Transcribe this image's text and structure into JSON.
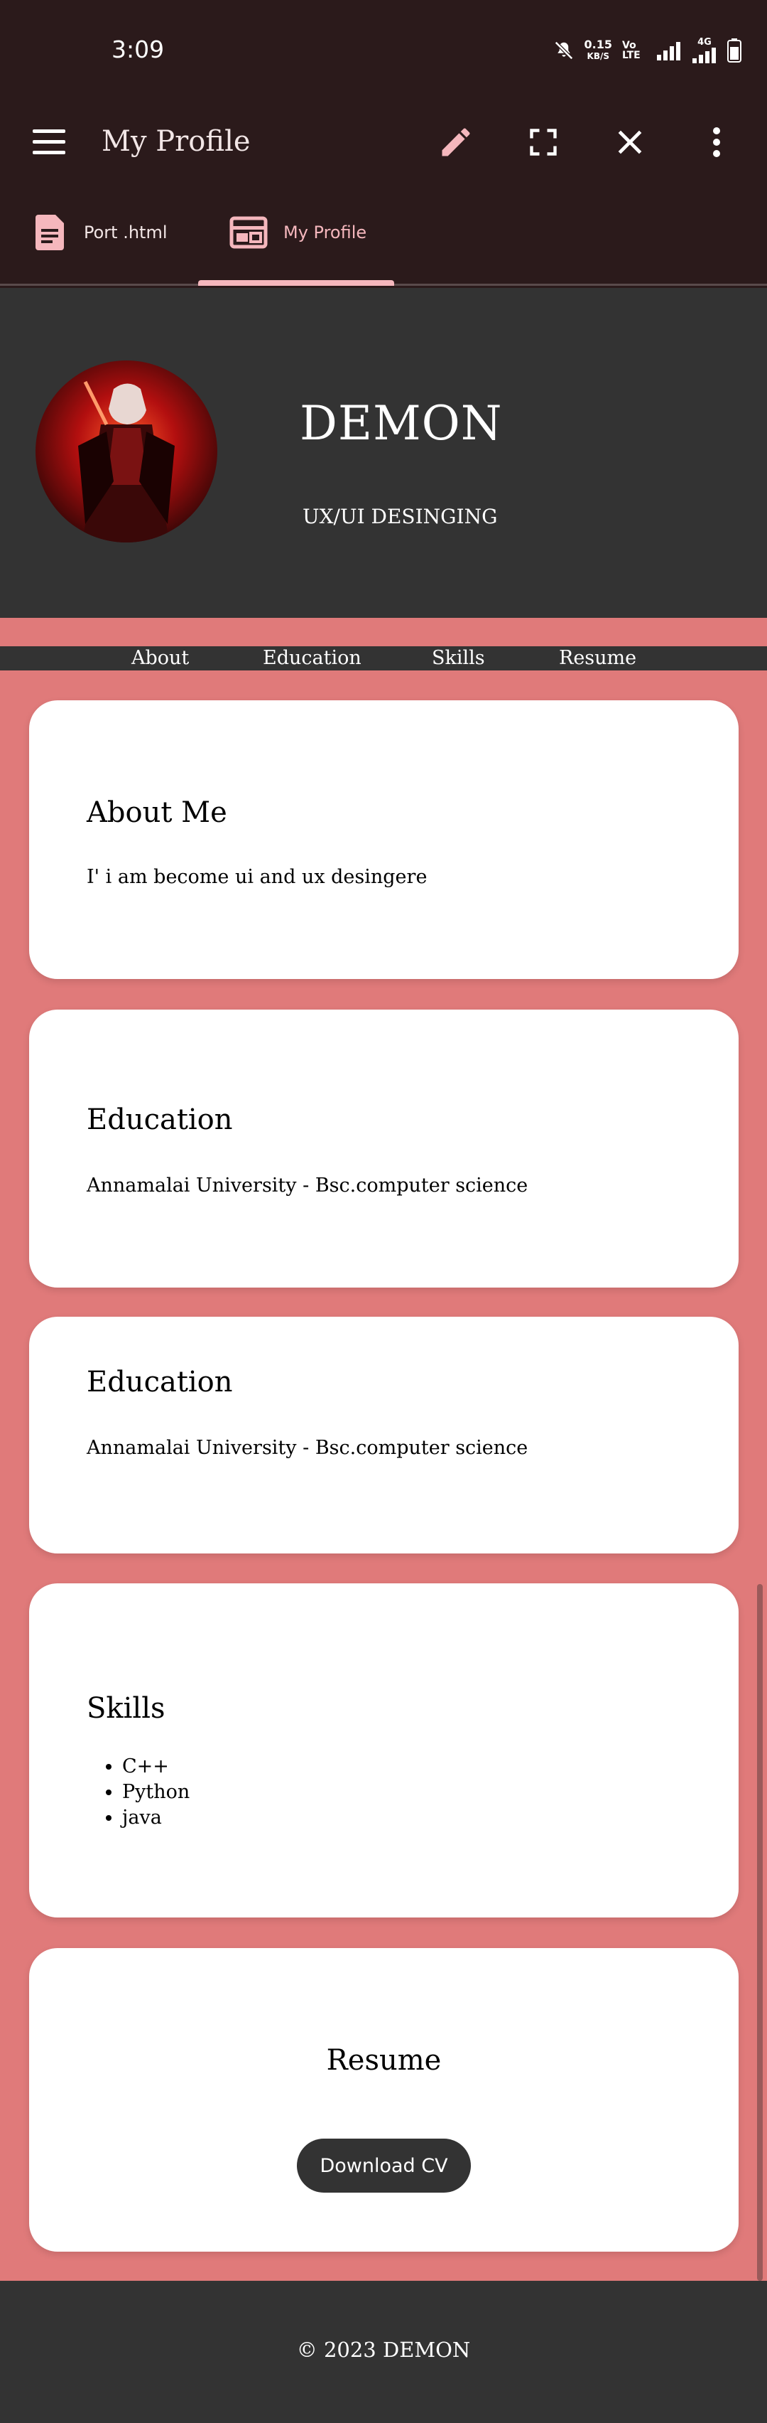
{
  "status": {
    "time": "3:09",
    "speed_value": "0.15",
    "speed_unit": "KB/S",
    "volte": "Vo LTE",
    "network": "4G"
  },
  "app_bar": {
    "title": "My Profile"
  },
  "tabs": [
    {
      "label": "Port .html",
      "active": false
    },
    {
      "label": "My Profile",
      "active": true
    }
  ],
  "profile": {
    "name": "DEMON",
    "role": "UX/UI DESINGING"
  },
  "nav": {
    "items": [
      "About",
      "Education",
      "Skills",
      "Resume"
    ]
  },
  "about": {
    "title": "About Me",
    "text": "I' i am become ui and ux desingere"
  },
  "education": [
    {
      "title": "Education",
      "text": "Annamalai University - Bsc.computer science"
    },
    {
      "title": "Education",
      "text": "Annamalai University - Bsc.computer science"
    }
  ],
  "skills": {
    "title": "Skills",
    "items": [
      "C++",
      "Python",
      "java"
    ]
  },
  "resume": {
    "title": "Resume",
    "button_label": "Download CV"
  },
  "footer": {
    "text": "© 2023 DEMON"
  },
  "colors": {
    "dark_bg": "#2b1a1b",
    "panel": "#333333",
    "accent_pink": "#f5b7bd",
    "page_pink": "#e07a7a"
  }
}
